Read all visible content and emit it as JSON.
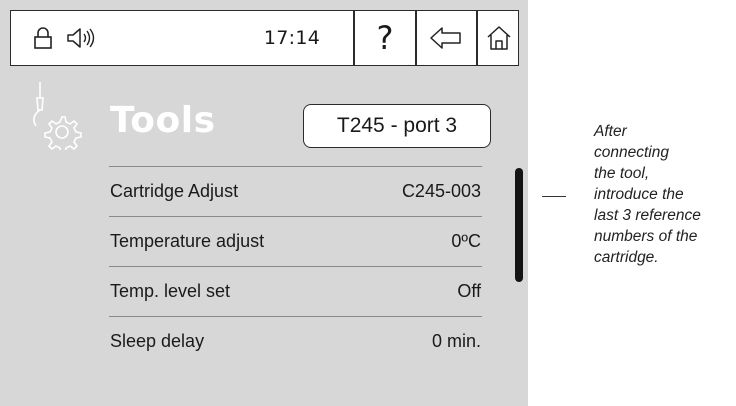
{
  "topbar": {
    "time": "17:14",
    "help_label": "?",
    "icons": [
      "lock-icon",
      "speaker-icon",
      "back-arrow-icon",
      "home-icon"
    ]
  },
  "header": {
    "title": "Tools",
    "tool_port": "T245 - port 3",
    "icon": "soldering-gear-icon"
  },
  "settings": [
    {
      "label": "Cartridge Adjust",
      "value": "C245-003"
    },
    {
      "label": "Temperature adjust",
      "value": "0ºC"
    },
    {
      "label": "Temp. level set",
      "value": "Off"
    },
    {
      "label": "Sleep delay",
      "value": "0 min."
    }
  ],
  "annotation": {
    "lines": [
      "After",
      "connecting",
      "the tool,",
      "introduce the",
      "last 3 reference",
      "numbers of the",
      "cartridge."
    ]
  },
  "colors": {
    "screen_bg": "#d7d7d7",
    "accent": "#141414",
    "title": "#ffffff"
  }
}
